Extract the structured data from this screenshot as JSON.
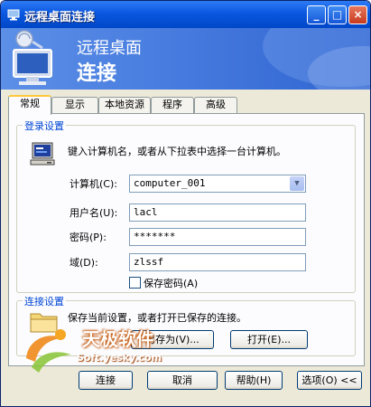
{
  "window": {
    "title": "远程桌面连接"
  },
  "banner": {
    "line1": "远程桌面",
    "line2": "连接"
  },
  "tabs": [
    {
      "label": "常规",
      "active": true
    },
    {
      "label": "显示",
      "active": false
    },
    {
      "label": "本地资源",
      "active": false
    },
    {
      "label": "程序",
      "active": false
    },
    {
      "label": "高级",
      "active": false
    }
  ],
  "login": {
    "group_label": "登录设置",
    "instructions": "键入计算机名，或者从下拉表中选择一台计算机。",
    "computer_label": "计算机(C):",
    "computer_value": "computer_001",
    "user_label": "用户名(U):",
    "user_value": "lacl",
    "password_label": "密码(P):",
    "password_value": "*******",
    "domain_label": "域(D):",
    "domain_value": "zlssf",
    "save_password_label": "保存密码(A)",
    "save_password_checked": false
  },
  "connection": {
    "group_label": "连接设置",
    "instructions": "保存当前设置，或者打开已保存的连接。",
    "save_as_label": "另存为(V)...",
    "open_label": "打开(E)..."
  },
  "footer": {
    "connect_label": "连接",
    "cancel_label": "取消",
    "help_label": "帮助(H)",
    "options_label": "选项(O) <<"
  },
  "watermark": {
    "line1": "天极软件",
    "line2": "Soft.yesky.com"
  },
  "colors": {
    "titlebar": "#0A58E0",
    "banner": "#4A7EE0",
    "group_label": "#0046D5",
    "face": "#ECE9D8"
  }
}
